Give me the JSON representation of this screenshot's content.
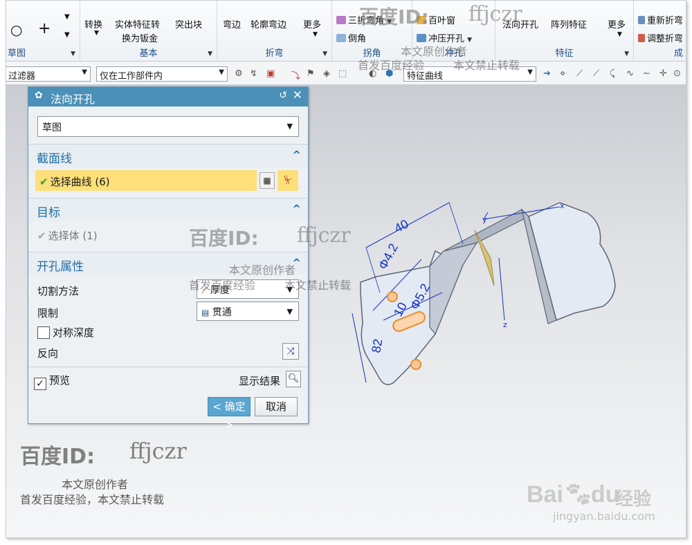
{
  "ribbon": {
    "groups": [
      {
        "label": "草图"
      },
      {
        "label": "基本"
      },
      {
        "label": "折弯"
      },
      {
        "label": "拐角"
      },
      {
        "label": "冲孔"
      },
      {
        "label": "特征"
      },
      {
        "label": "成"
      }
    ],
    "buttons": {
      "convert": "转换",
      "solid_convert": "实体特征转",
      "solid_convert_2": "换为钣金",
      "emboss": "突出块",
      "flange": "弯边",
      "contour_flange": "轮廓弯边",
      "more": "更多",
      "three_fold": "三折弯角",
      "chamfer": "倒角",
      "louver": "百叶窗",
      "punch": "冲压开孔",
      "normal_cutout": "法向开孔",
      "pattern_feature": "阵列特征",
      "more2": "更多",
      "refold": "重新折弯",
      "adjust_fold": "调整折弯"
    }
  },
  "filterbar": {
    "filter": "过滤器",
    "scope": "仅在工作部件内",
    "curve_rule": "特征曲线"
  },
  "dialog": {
    "title": "法向开孔",
    "type_value": "草图",
    "section_curve": {
      "title": "截面线",
      "select_label": "选择曲线 (6)"
    },
    "target": {
      "title": "目标",
      "select_label": "选择体 (1)"
    },
    "props": {
      "title": "开孔属性",
      "cut_method_label": "切割方法",
      "cut_method_value": "厚度",
      "limit_label": "限制",
      "limit_value": "贯通",
      "symmetric_label": "对称深度",
      "reverse_label": "反向"
    },
    "preview_label": "预览",
    "show_result_label": "显示结果",
    "ok_label": "< 确定 >",
    "cancel_label": "取消"
  },
  "model": {
    "dims": [
      "40",
      "Φ4.2",
      "Φ5.2",
      "10",
      "82"
    ],
    "axes": [
      "x",
      "y",
      "z"
    ]
  },
  "watermarks": {
    "id_label": "百度ID:",
    "id_value": "ffjczr",
    "line1": "本文原创作者",
    "line2a": "首发百度经验",
    "line2b": "本文禁止转载",
    "line2_joined": "首发百度经验，本文禁止转载",
    "baidu_logo": "Bai",
    "baidu_logo2": "du",
    "jingyan": "经验",
    "jingyan_url": "jingyan.baidu.com"
  },
  "colors": {
    "title_bar": "#4a90b8",
    "section_text": "#1e6ea6",
    "highlight_row": "#fde07a",
    "ok_button": "#5aa6d2",
    "model_face": "#e4eaf3",
    "model_edge": "#5b6575",
    "dimension": "#1030c8",
    "selection": "#f08a24"
  }
}
